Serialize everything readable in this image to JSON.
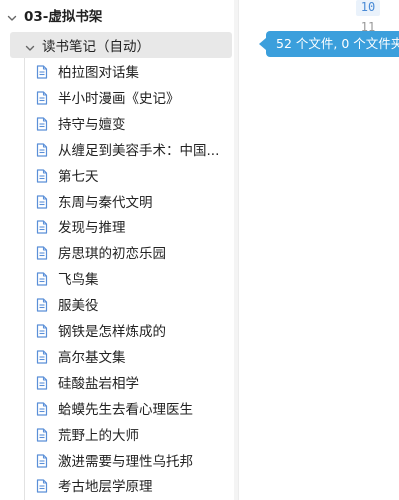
{
  "tree": {
    "root": {
      "label": "03-虚拟书架",
      "expanded": true
    },
    "folder": {
      "label": "读书笔记（自动）",
      "expanded": true,
      "selected": true
    },
    "files": [
      {
        "label": "柏拉图对话集"
      },
      {
        "label": "半小时漫画《史记》"
      },
      {
        "label": "持守与嬗变"
      },
      {
        "label": "从缠足到美容手术：中国..."
      },
      {
        "label": "第七天"
      },
      {
        "label": "东周与秦代文明"
      },
      {
        "label": "发现与推理"
      },
      {
        "label": "房思琪的初恋乐园"
      },
      {
        "label": "飞鸟集"
      },
      {
        "label": "服美役"
      },
      {
        "label": "钢铁是怎样炼成的"
      },
      {
        "label": "高尔基文集"
      },
      {
        "label": "硅酸盐岩相学"
      },
      {
        "label": "蛤蟆先生去看心理医生"
      },
      {
        "label": "荒野上的大师"
      },
      {
        "label": "激进需要与理性乌托邦"
      },
      {
        "label": "考古地层学原理"
      }
    ]
  },
  "editor": {
    "line_numbers": [
      "10",
      "11"
    ]
  },
  "tooltip": {
    "text": "52 个文件, 0 个文件夹"
  },
  "colors": {
    "accent": "#3b9fdc",
    "selected_row_bg": "#e8e8e8",
    "file_icon": "#5a8fd8"
  },
  "icons": {
    "root_chevron": "chevron-down-icon",
    "folder_chevron": "chevron-down-icon",
    "file": "file-document-icon"
  }
}
